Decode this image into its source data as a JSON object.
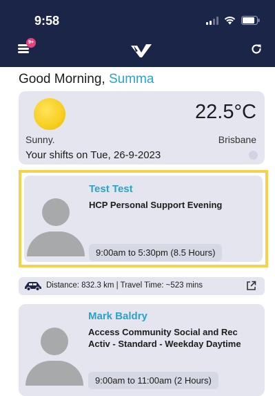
{
  "status_bar": {
    "time": "9:58"
  },
  "header": {
    "notification_badge": "9+",
    "menu_icon": "hamburger-menu-icon",
    "logo_icon": "v-logo-icon",
    "refresh_icon": "refresh-icon"
  },
  "greeting": {
    "text": "Good Morning,",
    "name": "Summa"
  },
  "weather": {
    "temperature": "22.5°C",
    "condition": "Sunny.",
    "city": "Brisbane",
    "shifts_label": "Your shifts on Tue, 26-9-2023"
  },
  "shifts": [
    {
      "client": "Test Test",
      "service": "HCP Personal Support Evening",
      "time": "9:00am to 5:30pm (8.5 Hours)"
    },
    {
      "client": "Mark Baldry",
      "service": "Access Community Social and Rec Activ - Standard - Weekday Daytime",
      "time": "9:00am to 11:00am (2 Hours)"
    }
  ],
  "travel": {
    "text": "Distance: 832.3 km | Travel Time: ~523 mins"
  },
  "colors": {
    "header_bg": "#1b2548",
    "accent": "#2aa3c9",
    "highlight": "#f6d24a",
    "card_bg": "#e4e5ef",
    "badge": "#e8407a"
  }
}
